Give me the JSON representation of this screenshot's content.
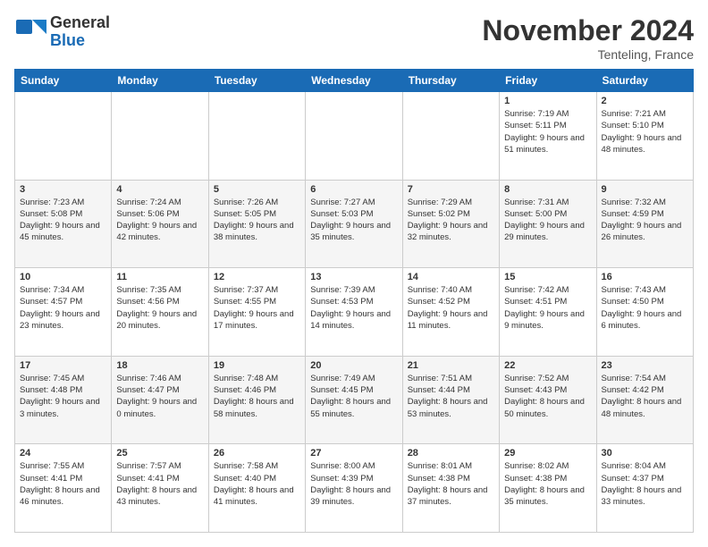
{
  "header": {
    "logo_general": "General",
    "logo_blue": "Blue",
    "month_title": "November 2024",
    "location": "Tenteling, France"
  },
  "days_of_week": [
    "Sunday",
    "Monday",
    "Tuesday",
    "Wednesday",
    "Thursday",
    "Friday",
    "Saturday"
  ],
  "weeks": [
    [
      {
        "day": "",
        "info": ""
      },
      {
        "day": "",
        "info": ""
      },
      {
        "day": "",
        "info": ""
      },
      {
        "day": "",
        "info": ""
      },
      {
        "day": "",
        "info": ""
      },
      {
        "day": "1",
        "info": "Sunrise: 7:19 AM\nSunset: 5:11 PM\nDaylight: 9 hours\nand 51 minutes."
      },
      {
        "day": "2",
        "info": "Sunrise: 7:21 AM\nSunset: 5:10 PM\nDaylight: 9 hours\nand 48 minutes."
      }
    ],
    [
      {
        "day": "3",
        "info": "Sunrise: 7:23 AM\nSunset: 5:08 PM\nDaylight: 9 hours\nand 45 minutes."
      },
      {
        "day": "4",
        "info": "Sunrise: 7:24 AM\nSunset: 5:06 PM\nDaylight: 9 hours\nand 42 minutes."
      },
      {
        "day": "5",
        "info": "Sunrise: 7:26 AM\nSunset: 5:05 PM\nDaylight: 9 hours\nand 38 minutes."
      },
      {
        "day": "6",
        "info": "Sunrise: 7:27 AM\nSunset: 5:03 PM\nDaylight: 9 hours\nand 35 minutes."
      },
      {
        "day": "7",
        "info": "Sunrise: 7:29 AM\nSunset: 5:02 PM\nDaylight: 9 hours\nand 32 minutes."
      },
      {
        "day": "8",
        "info": "Sunrise: 7:31 AM\nSunset: 5:00 PM\nDaylight: 9 hours\nand 29 minutes."
      },
      {
        "day": "9",
        "info": "Sunrise: 7:32 AM\nSunset: 4:59 PM\nDaylight: 9 hours\nand 26 minutes."
      }
    ],
    [
      {
        "day": "10",
        "info": "Sunrise: 7:34 AM\nSunset: 4:57 PM\nDaylight: 9 hours\nand 23 minutes."
      },
      {
        "day": "11",
        "info": "Sunrise: 7:35 AM\nSunset: 4:56 PM\nDaylight: 9 hours\nand 20 minutes."
      },
      {
        "day": "12",
        "info": "Sunrise: 7:37 AM\nSunset: 4:55 PM\nDaylight: 9 hours\nand 17 minutes."
      },
      {
        "day": "13",
        "info": "Sunrise: 7:39 AM\nSunset: 4:53 PM\nDaylight: 9 hours\nand 14 minutes."
      },
      {
        "day": "14",
        "info": "Sunrise: 7:40 AM\nSunset: 4:52 PM\nDaylight: 9 hours\nand 11 minutes."
      },
      {
        "day": "15",
        "info": "Sunrise: 7:42 AM\nSunset: 4:51 PM\nDaylight: 9 hours\nand 9 minutes."
      },
      {
        "day": "16",
        "info": "Sunrise: 7:43 AM\nSunset: 4:50 PM\nDaylight: 9 hours\nand 6 minutes."
      }
    ],
    [
      {
        "day": "17",
        "info": "Sunrise: 7:45 AM\nSunset: 4:48 PM\nDaylight: 9 hours\nand 3 minutes."
      },
      {
        "day": "18",
        "info": "Sunrise: 7:46 AM\nSunset: 4:47 PM\nDaylight: 9 hours\nand 0 minutes."
      },
      {
        "day": "19",
        "info": "Sunrise: 7:48 AM\nSunset: 4:46 PM\nDaylight: 8 hours\nand 58 minutes."
      },
      {
        "day": "20",
        "info": "Sunrise: 7:49 AM\nSunset: 4:45 PM\nDaylight: 8 hours\nand 55 minutes."
      },
      {
        "day": "21",
        "info": "Sunrise: 7:51 AM\nSunset: 4:44 PM\nDaylight: 8 hours\nand 53 minutes."
      },
      {
        "day": "22",
        "info": "Sunrise: 7:52 AM\nSunset: 4:43 PM\nDaylight: 8 hours\nand 50 minutes."
      },
      {
        "day": "23",
        "info": "Sunrise: 7:54 AM\nSunset: 4:42 PM\nDaylight: 8 hours\nand 48 minutes."
      }
    ],
    [
      {
        "day": "24",
        "info": "Sunrise: 7:55 AM\nSunset: 4:41 PM\nDaylight: 8 hours\nand 46 minutes."
      },
      {
        "day": "25",
        "info": "Sunrise: 7:57 AM\nSunset: 4:41 PM\nDaylight: 8 hours\nand 43 minutes."
      },
      {
        "day": "26",
        "info": "Sunrise: 7:58 AM\nSunset: 4:40 PM\nDaylight: 8 hours\nand 41 minutes."
      },
      {
        "day": "27",
        "info": "Sunrise: 8:00 AM\nSunset: 4:39 PM\nDaylight: 8 hours\nand 39 minutes."
      },
      {
        "day": "28",
        "info": "Sunrise: 8:01 AM\nSunset: 4:38 PM\nDaylight: 8 hours\nand 37 minutes."
      },
      {
        "day": "29",
        "info": "Sunrise: 8:02 AM\nSunset: 4:38 PM\nDaylight: 8 hours\nand 35 minutes."
      },
      {
        "day": "30",
        "info": "Sunrise: 8:04 AM\nSunset: 4:37 PM\nDaylight: 8 hours\nand 33 minutes."
      }
    ]
  ]
}
